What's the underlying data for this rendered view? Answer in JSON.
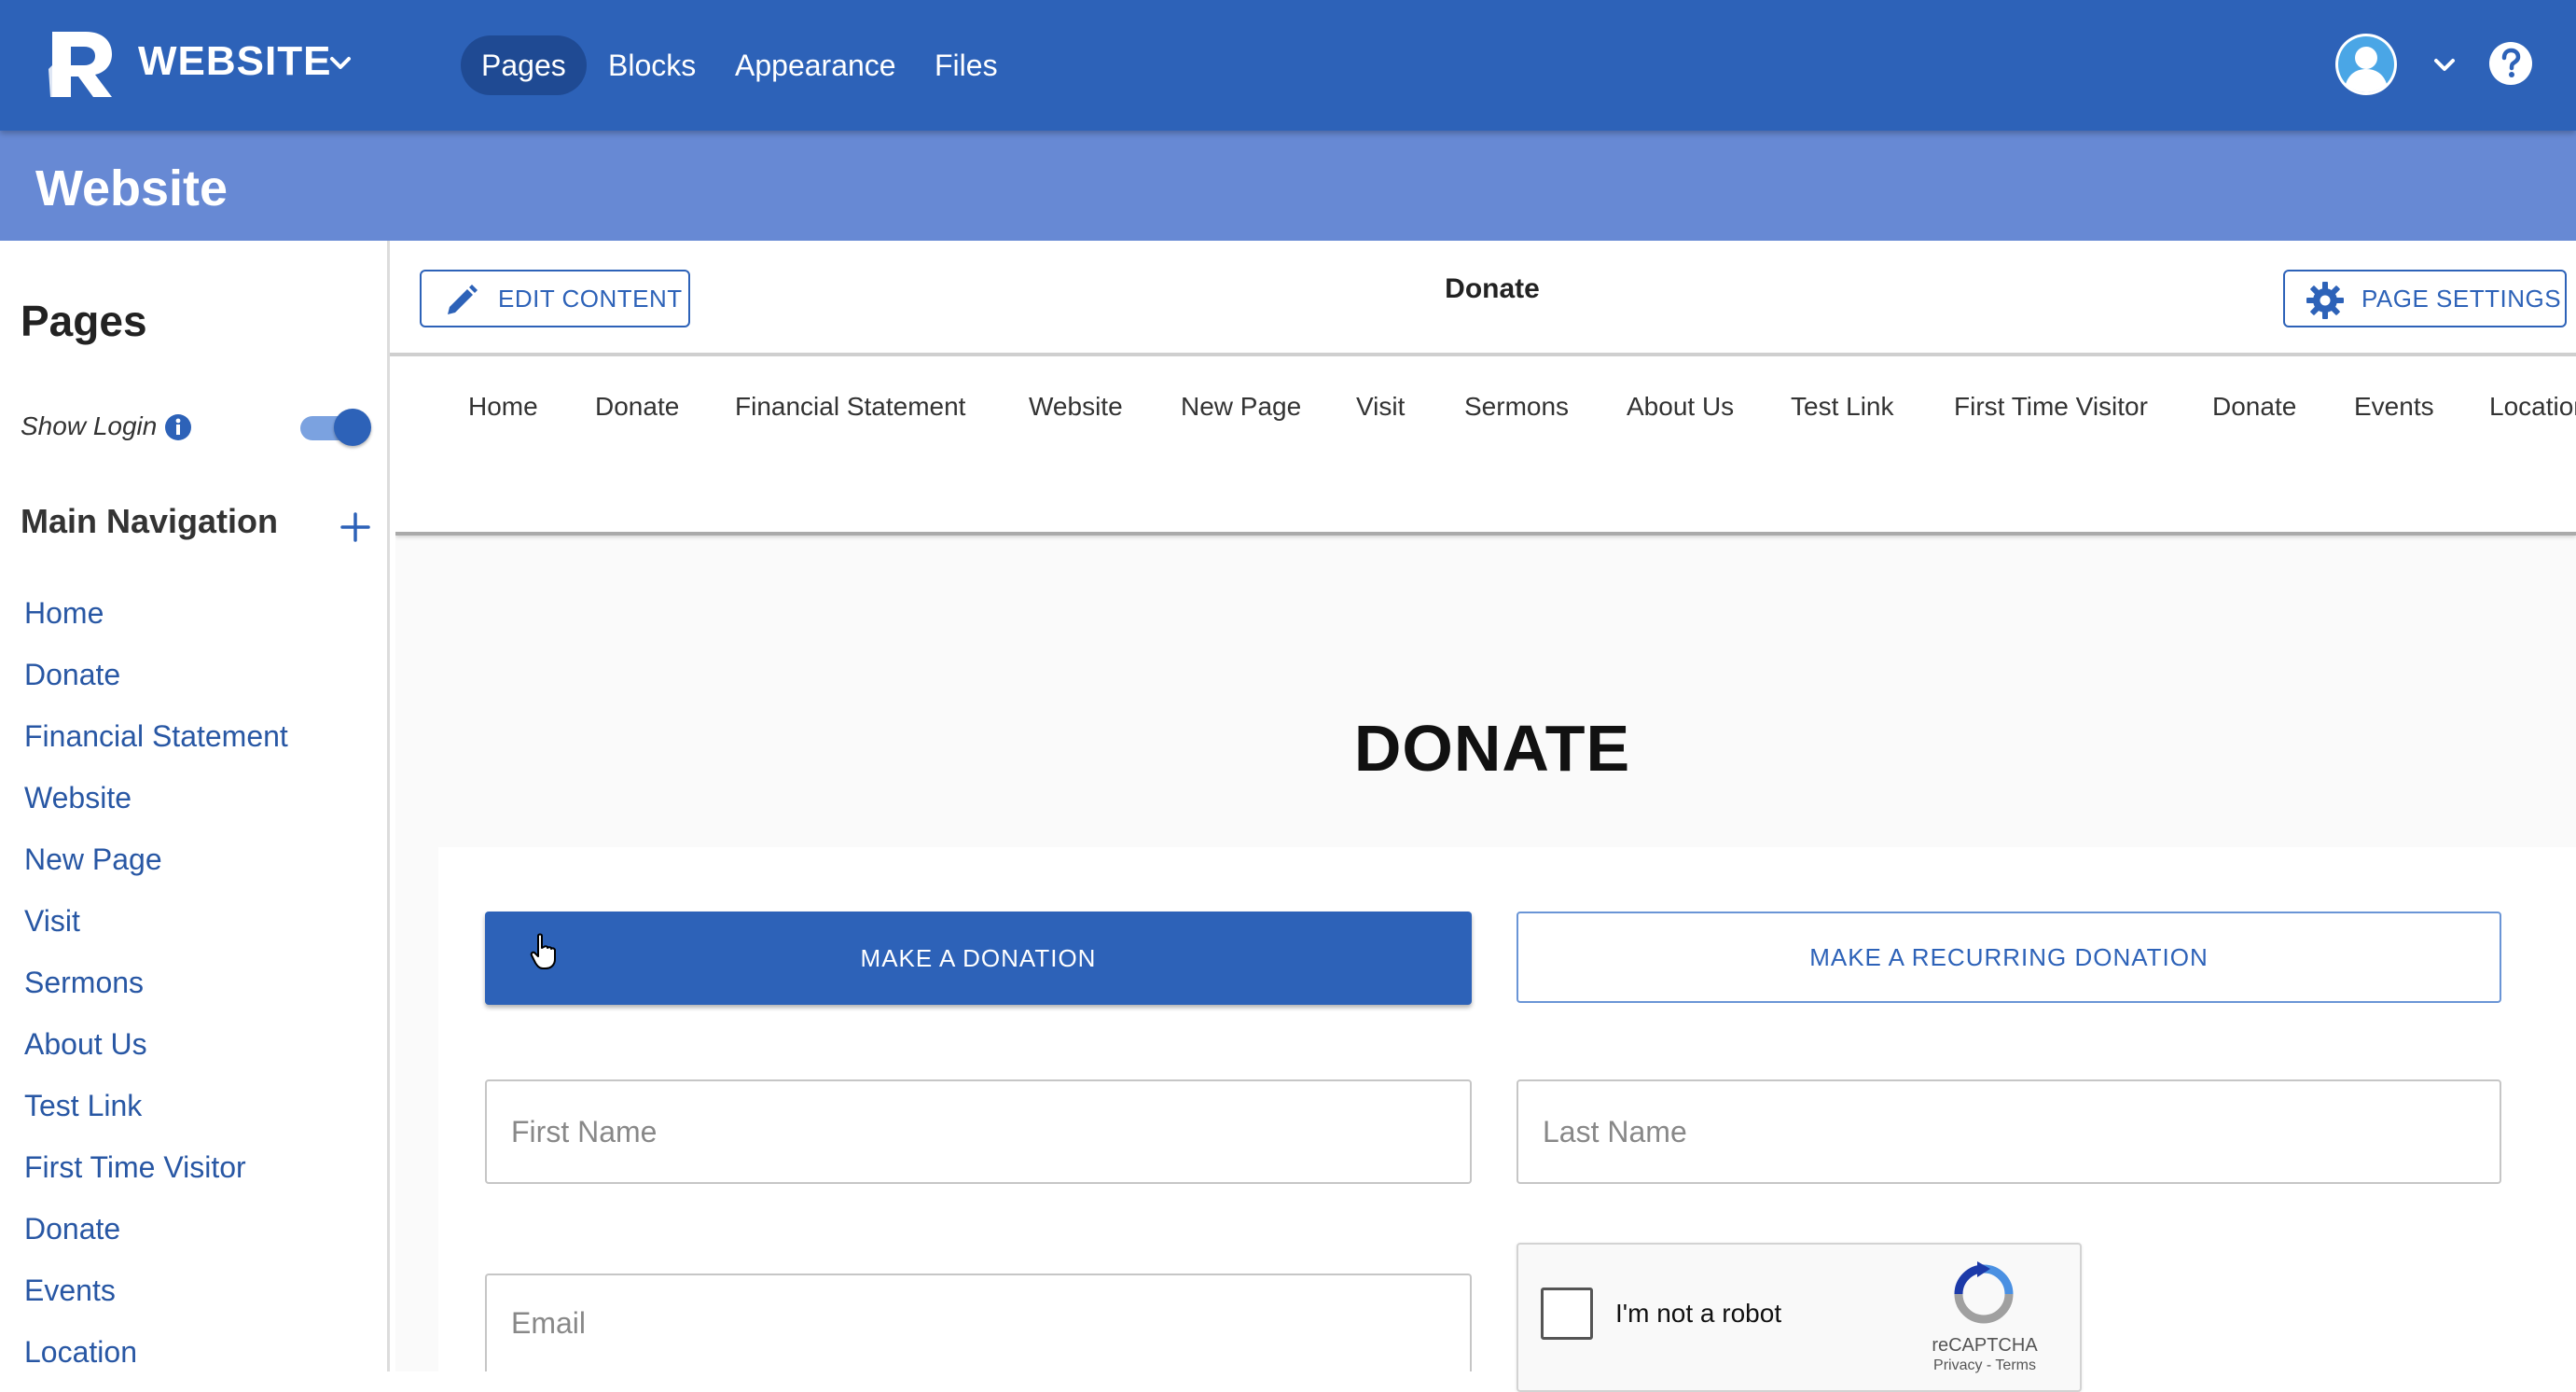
{
  "app": {
    "site_name": "WEBSITE",
    "nav_tabs": [
      "Pages",
      "Blocks",
      "Appearance",
      "Files"
    ],
    "active_tab": "Pages"
  },
  "header": {
    "title": "Website"
  },
  "sidebar": {
    "title": "Pages",
    "show_login_label": "Show Login",
    "show_login_enabled": true,
    "main_nav_title": "Main Navigation",
    "items": [
      "Home",
      "Donate",
      "Financial Statement",
      "Website",
      "New Page",
      "Visit",
      "Sermons",
      "About Us",
      "Test Link",
      "First Time Visitor",
      "Donate",
      "Events",
      "Location"
    ]
  },
  "toolbar": {
    "edit_label": "EDIT CONTENT",
    "page_title": "Donate",
    "settings_label": "PAGE SETTINGS"
  },
  "preview": {
    "nav_items": [
      "Home",
      "Donate",
      "Financial Statement",
      "Website",
      "New Page",
      "Visit",
      "Sermons",
      "About Us",
      "Test Link",
      "First Time Visitor",
      "Donate",
      "Events",
      "Location"
    ],
    "heading": "DONATE",
    "donate_button": "MAKE A DONATION",
    "recurring_button": "MAKE A RECURRING DONATION",
    "first_name_placeholder": "First Name",
    "last_name_placeholder": "Last Name",
    "email_placeholder": "Email",
    "captcha_label": "I'm not a robot",
    "captcha_brand": "reCAPTCHA",
    "captcha_links": "Privacy - Terms"
  },
  "colors": {
    "topbar": "#2d62b8",
    "header": "#6789d4",
    "accent": "#2d62b8",
    "link": "#2857a4"
  },
  "icons": [
    "logo-icon",
    "chevron-down-icon",
    "avatar-icon",
    "help-icon",
    "info-icon",
    "plus-icon",
    "pencil-icon",
    "gear-icon",
    "recaptcha-icon",
    "cursor-icon"
  ]
}
